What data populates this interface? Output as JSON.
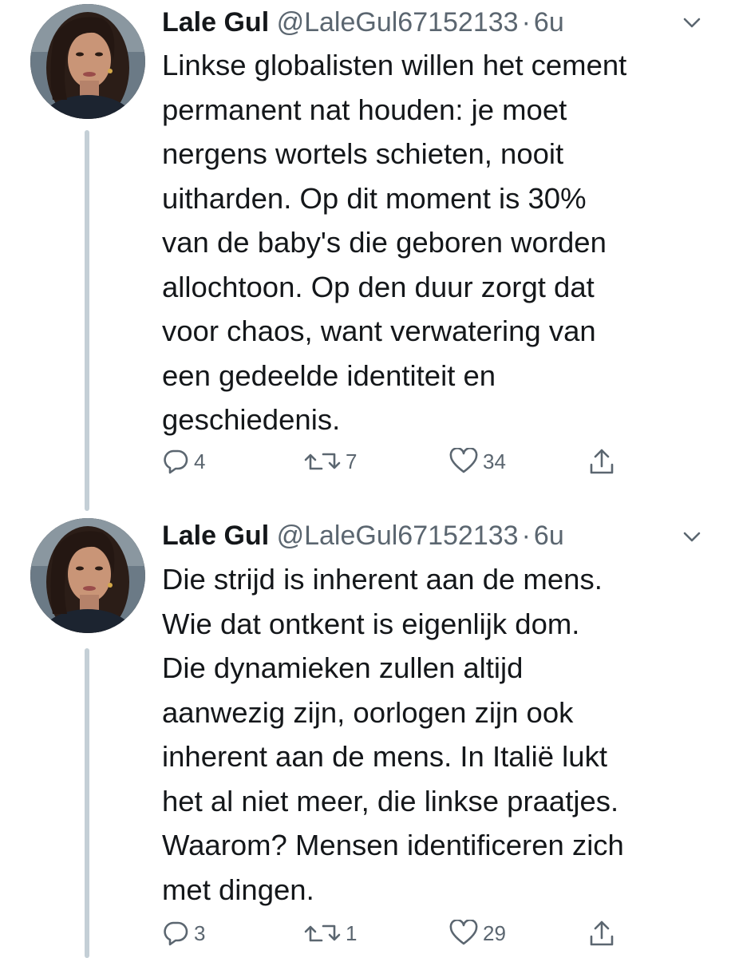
{
  "tweets": [
    {
      "author_name": "Lale Gul",
      "handle": "@LaleGul67152133",
      "separator": "·",
      "time": "6u",
      "avatar_icon": "profile-photo",
      "text": "Linkse globalisten willen het cement\npermanent nat houden: je moet\nnergens wortels schieten, nooit\nuitharden. Op dit moment is 30%\nvan de baby's die geboren worden\nallochtoon. Op den duur zorgt dat\nvoor chaos, want verwatering van\neen gedeelde identiteit en\ngeschiedenis.",
      "replies": "4",
      "retweets": "7",
      "likes": "34"
    },
    {
      "author_name": "Lale Gul",
      "handle": "@LaleGul67152133",
      "separator": "·",
      "time": "6u",
      "avatar_icon": "profile-photo",
      "text": "Die strijd is inherent aan de mens.\nWie dat ontkent is eigenlijk dom.\nDie dynamieken zullen altijd\naanwezig zijn, oorlogen zijn ook\ninherent aan de mens. In Italië lukt\nhet al niet meer, die linkse praatjes.\nWaarom? Mensen identificeren zich\nmet dingen.",
      "replies": "3",
      "retweets": "1",
      "likes": "29"
    }
  ],
  "colors": {
    "text": "#14171a",
    "secondary": "#5b6670",
    "thread_line": "#c4cfd6",
    "background": "#ffffff"
  },
  "icons": [
    "reply-icon",
    "retweet-icon",
    "like-icon",
    "share-icon",
    "chevron-down-icon"
  ]
}
